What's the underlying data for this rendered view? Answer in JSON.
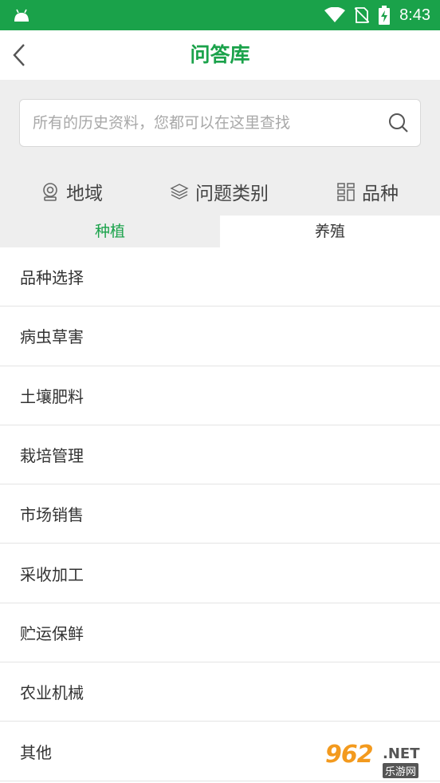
{
  "status_bar": {
    "time": "8:43"
  },
  "header": {
    "title": "问答库"
  },
  "search": {
    "placeholder": "所有的历史资料，您都可以在这里查找"
  },
  "filters": [
    {
      "label": "地域",
      "icon": "location-pin-icon"
    },
    {
      "label": "问题类别",
      "icon": "layers-icon"
    },
    {
      "label": "品种",
      "icon": "grid-icon"
    }
  ],
  "tabs": [
    {
      "label": "种植",
      "active": true
    },
    {
      "label": "养殖",
      "active": false
    }
  ],
  "list": [
    {
      "label": "品种选择"
    },
    {
      "label": "病虫草害"
    },
    {
      "label": "土壤肥料"
    },
    {
      "label": "栽培管理"
    },
    {
      "label": "市场销售"
    },
    {
      "label": "采收加工"
    },
    {
      "label": "贮运保鲜"
    },
    {
      "label": "农业机械"
    },
    {
      "label": "其他"
    }
  ],
  "watermark": {
    "logo": "962",
    "suffix": ".NET",
    "text": "乐游网"
  },
  "colors": {
    "primary": "#1aa24a",
    "background_gray": "#eeeeee"
  }
}
